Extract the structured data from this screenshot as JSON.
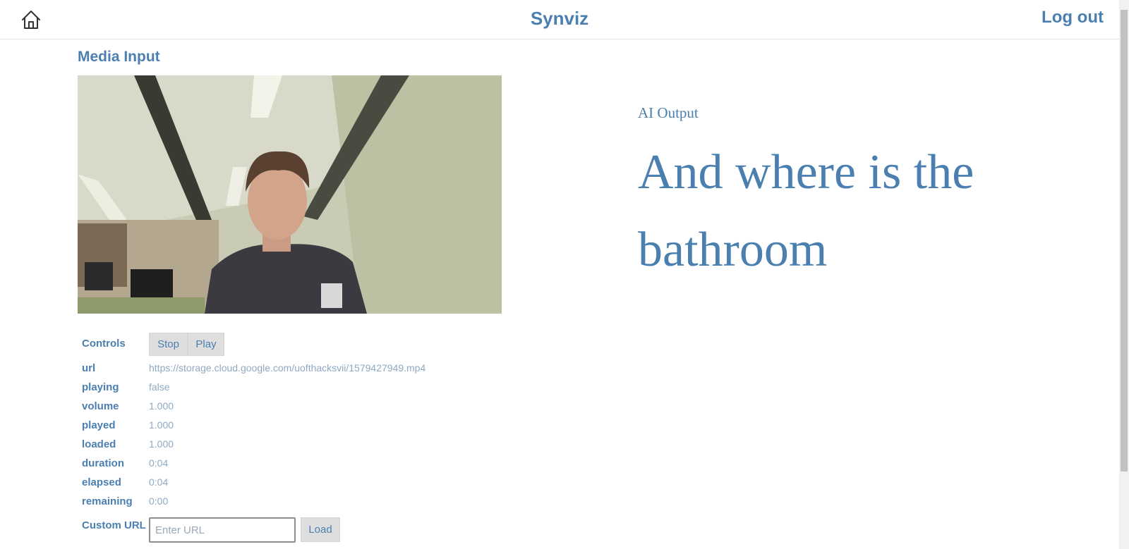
{
  "header": {
    "title": "Synviz",
    "logout_label": "Log out"
  },
  "media": {
    "section_title": "Media Input"
  },
  "controls": {
    "label": "Controls",
    "stop_label": "Stop",
    "play_label": "Play",
    "fields": [
      {
        "key": "url",
        "value": "https://storage.cloud.google.com/uofthacksvii/1579427949.mp4"
      },
      {
        "key": "playing",
        "value": "false"
      },
      {
        "key": "volume",
        "value": "1.000"
      },
      {
        "key": "played",
        "value": "1.000"
      },
      {
        "key": "loaded",
        "value": "1.000"
      },
      {
        "key": "duration",
        "value": "0:04"
      },
      {
        "key": "elapsed",
        "value": "0:04"
      },
      {
        "key": "remaining",
        "value": "0:00"
      }
    ],
    "custom_url_label": "Custom URL",
    "url_placeholder": "Enter URL",
    "load_label": "Load"
  },
  "ai": {
    "label": "AI Output",
    "text": "And where is the bathroom"
  },
  "icons": {
    "home": "home-icon"
  },
  "colors": {
    "accent": "#4a7fb0",
    "muted_value": "#8fa9c4",
    "button_bg": "#dedede"
  }
}
